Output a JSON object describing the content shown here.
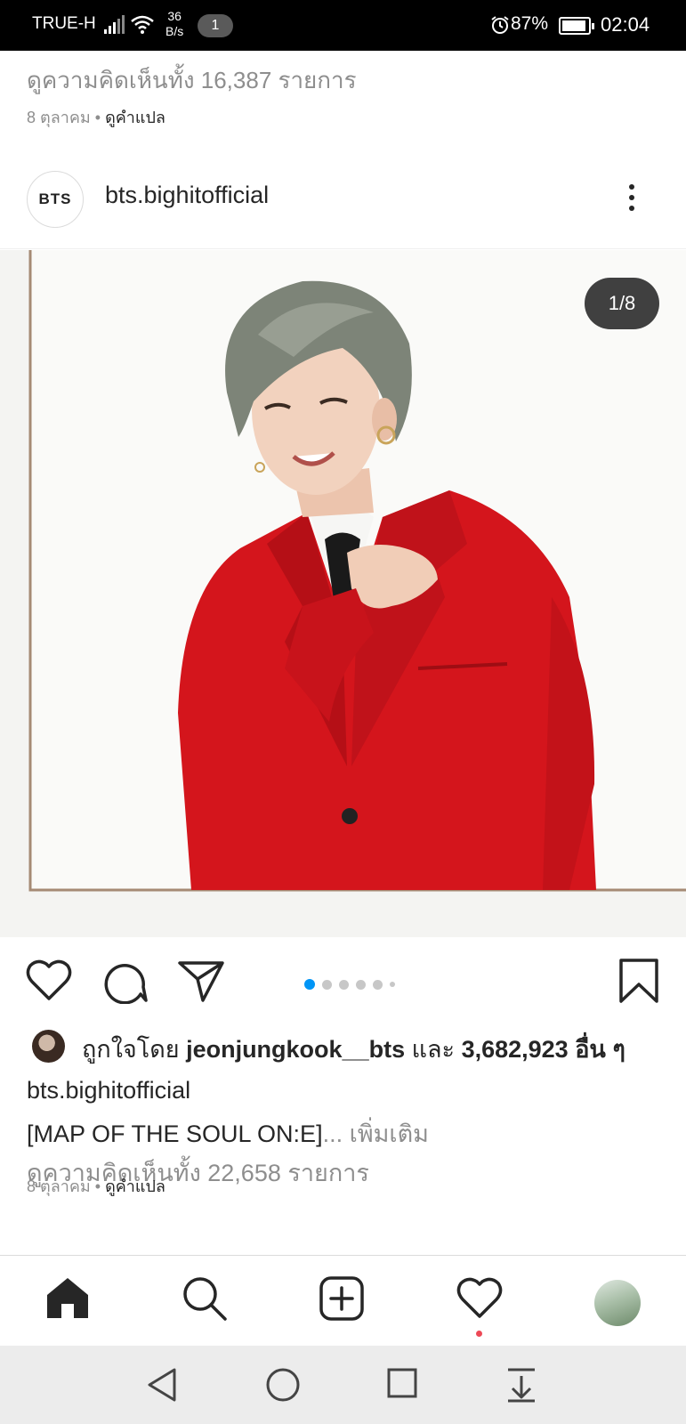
{
  "status_bar": {
    "carrier": "TRUE-H",
    "net_speed_value": "36",
    "net_speed_unit": "B/s",
    "notification_count": "1",
    "battery": "87%",
    "time": "02:04"
  },
  "previous_post": {
    "view_comments": "ดูความคิดเห็นทั้ง 16,387 รายการ",
    "date": "8 ตุลาคม",
    "separator": " • ",
    "see_translation": "ดูคำแปล"
  },
  "post": {
    "avatar_text": "BTS",
    "username": "bts.bighitofficial",
    "image_counter": "1/8",
    "carousel": {
      "total": 6,
      "active": 0
    },
    "likes": {
      "prefix": "ถูกใจโดย ",
      "liker": "jeonjungkook__bts",
      "middle": " และ ",
      "count": "3,682,923",
      "suffix": " อื่น ๆ"
    },
    "caption_user": "bts.bighitofficial",
    "caption_text": "[MAP OF THE SOUL ON:E]",
    "caption_more": "... เพิ่มเติม",
    "view_comments": "ดูความคิดเห็นทั้ง 22,658 รายการ",
    "date": "8 ตุลาคม",
    "separator": " • ",
    "see_translation": "ดูคำแปล"
  },
  "icons": {
    "like": "heart-icon",
    "comment": "comment-icon",
    "share": "send-icon",
    "save": "bookmark-icon",
    "nav_home": "home-icon",
    "nav_search": "search-icon",
    "nav_add": "add-post-icon",
    "nav_activity": "heart-icon",
    "sys_back": "back-triangle-icon",
    "sys_home": "home-circle-icon",
    "sys_recents": "recents-square-icon",
    "sys_notifications": "pull-down-icon"
  },
  "colors": {
    "accent_blue": "#0095f6",
    "notification_red": "#ed4956",
    "secondary_text": "#8e8e8e",
    "jacket_red": "#d4151c"
  }
}
